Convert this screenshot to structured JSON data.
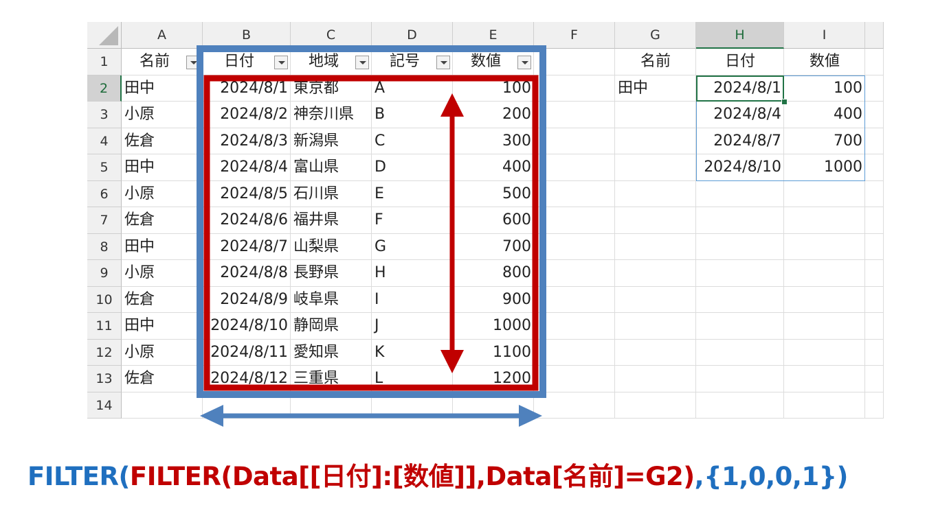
{
  "columns": [
    "A",
    "B",
    "C",
    "D",
    "E",
    "F",
    "G",
    "H",
    "I"
  ],
  "selected_column": "H",
  "rows": [
    "1",
    "2",
    "3",
    "4",
    "5",
    "6",
    "7",
    "8",
    "9",
    "10",
    "11",
    "12",
    "13",
    "14"
  ],
  "selected_row": "2",
  "table": {
    "headers": [
      "名前",
      "日付",
      "地域",
      "記号",
      "数値"
    ],
    "rows": [
      [
        "田中",
        "2024/8/1",
        "東京都",
        "A",
        "100"
      ],
      [
        "小原",
        "2024/8/2",
        "神奈川県",
        "B",
        "200"
      ],
      [
        "佐倉",
        "2024/8/3",
        "新潟県",
        "C",
        "300"
      ],
      [
        "田中",
        "2024/8/4",
        "富山県",
        "D",
        "400"
      ],
      [
        "小原",
        "2024/8/5",
        "石川県",
        "E",
        "500"
      ],
      [
        "佐倉",
        "2024/8/6",
        "福井県",
        "F",
        "600"
      ],
      [
        "田中",
        "2024/8/7",
        "山梨県",
        "G",
        "700"
      ],
      [
        "小原",
        "2024/8/8",
        "長野県",
        "H",
        "800"
      ],
      [
        "佐倉",
        "2024/8/9",
        "岐阜県",
        "I",
        "900"
      ],
      [
        "田中",
        "2024/8/10",
        "静岡県",
        "J",
        "1000"
      ],
      [
        "小原",
        "2024/8/11",
        "愛知県",
        "K",
        "1100"
      ],
      [
        "佐倉",
        "2024/8/12",
        "三重県",
        "L",
        "1200"
      ]
    ]
  },
  "result": {
    "headers": [
      "名前",
      "日付",
      "数値"
    ],
    "name_value": "田中",
    "rows": [
      [
        "2024/8/1",
        "100"
      ],
      [
        "2024/8/4",
        "400"
      ],
      [
        "2024/8/7",
        "700"
      ],
      [
        "2024/8/10",
        "1000"
      ]
    ]
  },
  "formula": {
    "part1": "FILTER(",
    "part2": "FILTER(Data[[日付]:[数値]],Data[名前]=G2)",
    "part3": ",{1,0,0,1})"
  },
  "colors": {
    "blue_box": "#4f81bd",
    "red_box": "#c00000",
    "selection": "#217346",
    "formula_blue": "#1f6fbf",
    "formula_red": "#c00000"
  }
}
